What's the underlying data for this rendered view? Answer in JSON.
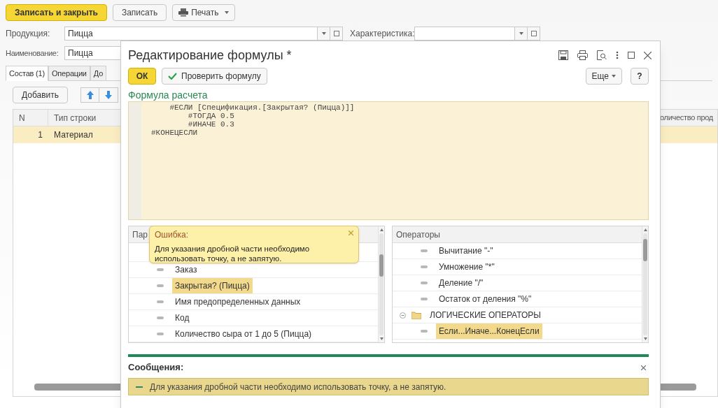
{
  "toolbar": [
    {
      "label": "Записать и закрыть",
      "kind": "primary"
    },
    {
      "label": "Записать",
      "kind": "plain"
    },
    {
      "label": "Печать",
      "kind": "print"
    }
  ],
  "product": {
    "label": "Продукция:",
    "value": "Пицца"
  },
  "characteristic": {
    "label": "Характеристика:"
  },
  "name": {
    "label": "Наименование:",
    "value": "Пицца"
  },
  "tabs": [
    {
      "label": "Состав (1)",
      "selected": true
    },
    {
      "label": "Операции",
      "selected": false
    },
    {
      "label": "До",
      "selected": false
    }
  ],
  "add_button": "Добавить",
  "table": {
    "columns": [
      "N",
      "Тип строки",
      "оличество прод"
    ],
    "rows": [
      {
        "cells": [
          "1",
          "Материал"
        ],
        "selected": true
      }
    ]
  },
  "dialog": {
    "title": "Редактирование формулы *",
    "ok": "ОК",
    "check": "Проверить формулу",
    "more": "Еще",
    "help": "?",
    "formula_label": "Формула расчета",
    "formula_lines": [
      "    #ЕСЛИ [Спецификация.[Закрытая? (Пицца)]]",
      "        #ТОГДА 0.5",
      "        #ИНАЧЕ 0.3",
      "#КОНЕЦЕСЛИ"
    ],
    "parameters": {
      "header": "Пар",
      "items": [
        {
          "kind": "item",
          "label": "Заказ",
          "selected": false
        },
        {
          "kind": "item",
          "label": "Закрытая? (Пицца)",
          "selected": true
        },
        {
          "kind": "item",
          "label": "Имя предопределенных данных",
          "selected": false
        },
        {
          "kind": "item",
          "label": "Код",
          "selected": false
        },
        {
          "kind": "item",
          "label": "Количество сыра от 1 до 5 (Пицца)",
          "selected": false
        }
      ]
    },
    "operators": {
      "header": "Операторы",
      "items": [
        {
          "kind": "item",
          "label": "Вычитание \"-\"",
          "selected": false
        },
        {
          "kind": "item",
          "label": "Умножение \"*\"",
          "selected": false
        },
        {
          "kind": "item",
          "label": "Деление \"/\"",
          "selected": false
        },
        {
          "kind": "item",
          "label": "Остаток от деления \"%\"",
          "selected": false
        },
        {
          "kind": "group",
          "label": "ЛОГИЧЕСКИЕ ОПЕРАТОРЫ",
          "expanded": true,
          "selected": false,
          "children": [
            {
              "kind": "item",
              "label": "Если...Иначе...КонецЕсли",
              "selected": true
            }
          ]
        }
      ]
    },
    "tooltip": {
      "title": "Ошибка:",
      "text": "Для указания дробной части необходимо использовать точку, а не запятую."
    },
    "messages": {
      "title": "Сообщения:",
      "items": [
        "Для указания дробной части необходимо использовать точку, а не запятую."
      ]
    }
  }
}
